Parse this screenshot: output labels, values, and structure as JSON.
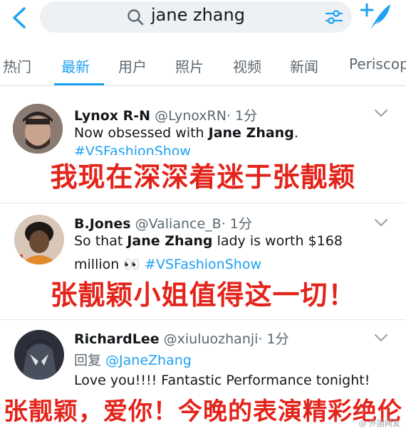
{
  "search": {
    "query": "jane zhang"
  },
  "tabs": [
    {
      "label": "热门"
    },
    {
      "label": "最新"
    },
    {
      "label": "用户"
    },
    {
      "label": "照片"
    },
    {
      "label": "视频"
    },
    {
      "label": "新闻"
    },
    {
      "label": "Periscop"
    }
  ],
  "tweets": [
    {
      "display_name": "Lynox R-N",
      "handle": "@LynoxRN",
      "time": "· 1分",
      "line1_pre": "Now obsessed with ",
      "line1_bold": "Jane Zhang",
      "line1_post": ".",
      "line2": "#VSFashionShow",
      "caption": "我现在深深着迷于张靓颖"
    },
    {
      "display_name": "B.Jones",
      "handle": "@Valiance_B",
      "time": "· 1分",
      "line1_pre": "So that ",
      "line1_bold": "Jane Zhang",
      "line1_post": " lady is worth $168",
      "line2_pre": "million 👀 ",
      "line2_tag": "#VSFashionShow",
      "caption": "张靓颖小姐值得这一切！"
    },
    {
      "display_name": "RichardLee",
      "handle": "@xiuluozhanji",
      "time": "· 1分",
      "reply_pre": "回复 ",
      "reply_to": "@JaneZhang",
      "line1": "Love you!!!! Fantastic Performance tonight!",
      "caption": "张靓颖，爱你！今晚的表演精彩绝伦"
    }
  ],
  "watermark": "@ 外国网友",
  "colors": {
    "accent": "#1da1f2",
    "caption_red": "#e3241b"
  }
}
